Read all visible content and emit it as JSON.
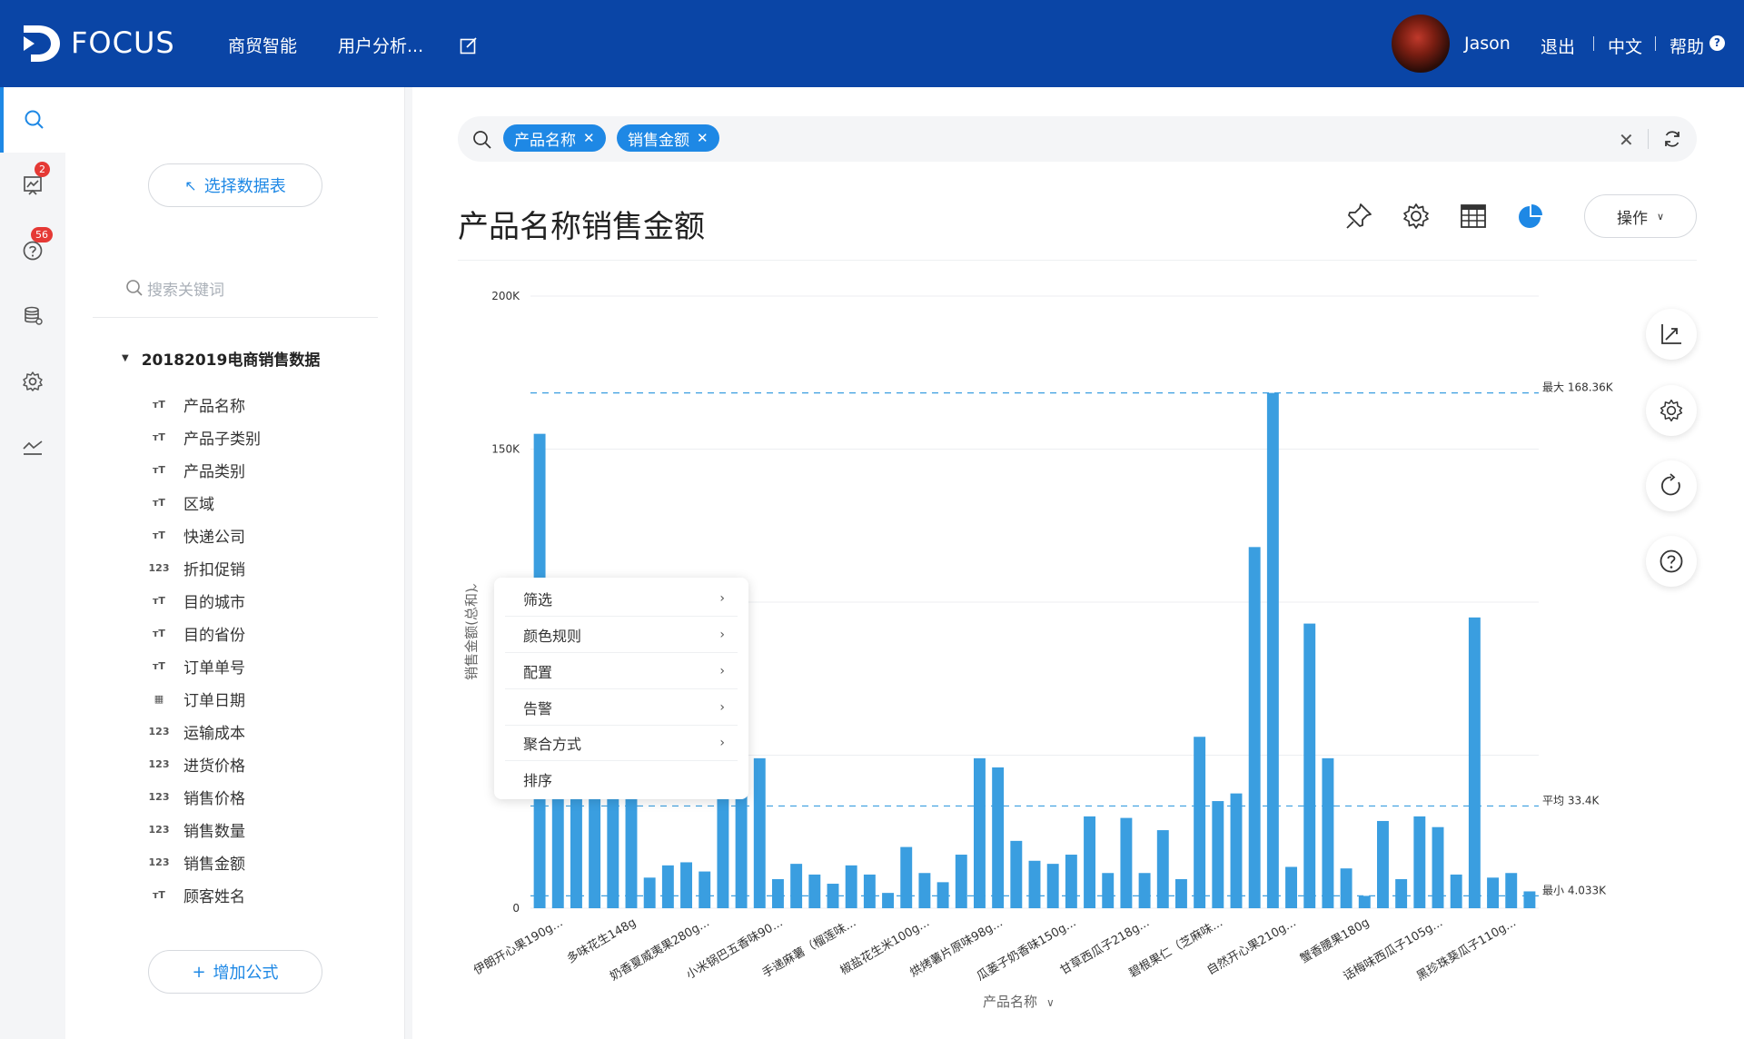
{
  "app": {
    "logo_text": "FOCUS"
  },
  "nav": {
    "items": [
      {
        "label": "商贸智能"
      },
      {
        "label": "用户分析..."
      }
    ]
  },
  "user": {
    "name": "Jason",
    "logout": "退出",
    "lang": "中文",
    "help": "帮助",
    "help_icon_text": "?"
  },
  "sidebar": {
    "badges": {
      "alerts": "2",
      "questions": "56"
    }
  },
  "data_panel": {
    "select_table": "选择数据表",
    "search_placeholder": "搜索关键词",
    "dataset_name": "20182019电商销售数据",
    "fields": [
      {
        "label": "产品名称",
        "type": "text"
      },
      {
        "label": "产品子类别",
        "type": "text"
      },
      {
        "label": "产品类别",
        "type": "text"
      },
      {
        "label": "区域",
        "type": "text"
      },
      {
        "label": "快递公司",
        "type": "text"
      },
      {
        "label": "折扣促销",
        "type": "number"
      },
      {
        "label": "目的城市",
        "type": "text"
      },
      {
        "label": "目的省份",
        "type": "text"
      },
      {
        "label": "订单单号",
        "type": "text"
      },
      {
        "label": "订单日期",
        "type": "date"
      },
      {
        "label": "运输成本",
        "type": "number"
      },
      {
        "label": "进货价格",
        "type": "number"
      },
      {
        "label": "销售价格",
        "type": "number"
      },
      {
        "label": "销售数量",
        "type": "number"
      },
      {
        "label": "销售金额",
        "type": "number"
      },
      {
        "label": "顾客姓名",
        "type": "text"
      }
    ],
    "add_formula": "增加公式"
  },
  "search": {
    "tokens": [
      {
        "label": "产品名称"
      },
      {
        "label": "销售金额"
      }
    ]
  },
  "main": {
    "title": "产品名称销售金额",
    "operations": "操作"
  },
  "context_menu": {
    "items": [
      {
        "label": "筛选",
        "has_sub": true
      },
      {
        "label": "颜色规则",
        "has_sub": true
      },
      {
        "label": "配置",
        "has_sub": true
      },
      {
        "label": "告警",
        "has_sub": true
      },
      {
        "label": "聚合方式",
        "has_sub": true
      },
      {
        "label": "排序",
        "has_sub": false
      }
    ]
  },
  "chart_data": {
    "type": "bar",
    "xlabel": "产品名称",
    "ylabel": "销售金额(总和)",
    "ylim": [
      0,
      200000
    ],
    "y_ticks": [
      {
        "value": 0,
        "label": "0"
      },
      {
        "value": 150000,
        "label": "150K"
      },
      {
        "value": 200000,
        "label": "200K"
      }
    ],
    "color": "#3a9ee0",
    "ref_lines": [
      {
        "label": "最大 168.36K",
        "value": 168360
      },
      {
        "label": "平均 33.4K",
        "value": 33400
      },
      {
        "label": "最小 4.033K",
        "value": 4033
      }
    ],
    "x_labels_visible": [
      "伊朗开心果190g...",
      "多味花生148g",
      "奶香夏威夷果280g...",
      "小米锅巴五香味90...",
      "手递麻薯（榴莲味...",
      "椒盐花生米100g...",
      "烘烤薯片原味98g...",
      "瓜蒌子奶香味150g...",
      "甘草西瓜子218g...",
      "碧根果仁（芝麻味...",
      "自然开心果210g...",
      "蟹香腰果180g",
      "话梅味西瓜子105g...",
      "黑珍珠葵瓜子110g..."
    ],
    "values": [
      155000,
      37000,
      37000,
      37000,
      37000,
      37000,
      10000,
      14000,
      15000,
      12000,
      37000,
      37000,
      49000,
      9500,
      14500,
      11000,
      8000,
      14000,
      11000,
      5000,
      20000,
      11500,
      8500,
      17500,
      49000,
      46000,
      22000,
      15500,
      14500,
      17500,
      30000,
      11500,
      29500,
      11500,
      25500,
      9500,
      56000,
      35000,
      37500,
      118000,
      168360,
      13500,
      93000,
      49000,
      13000,
      4033,
      28500,
      9500,
      30000,
      26500,
      11000,
      95000,
      10000,
      11500,
      5500
    ]
  }
}
